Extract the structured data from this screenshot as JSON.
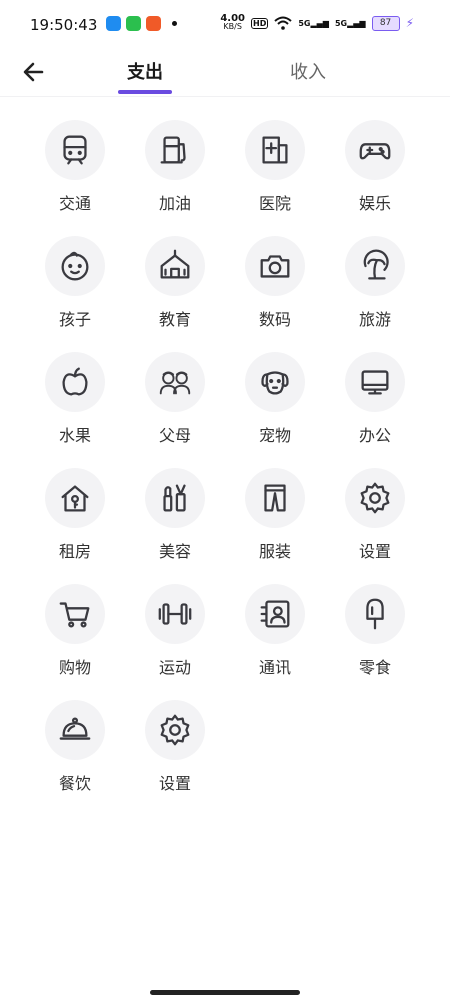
{
  "status_bar": {
    "time": "19:50:43",
    "net_speed_value": "4.00",
    "net_speed_unit": "KB/S",
    "hd": "HD",
    "signal1": "5G",
    "signal2": "5G",
    "battery": "87"
  },
  "header": {
    "tab_expense": "支出",
    "tab_income": "收入"
  },
  "categories": [
    {
      "label": "交通",
      "icon": "train-icon"
    },
    {
      "label": "加油",
      "icon": "fuel-pump-icon"
    },
    {
      "label": "医院",
      "icon": "hospital-icon"
    },
    {
      "label": "娱乐",
      "icon": "gamepad-icon"
    },
    {
      "label": "孩子",
      "icon": "baby-face-icon"
    },
    {
      "label": "教育",
      "icon": "school-icon"
    },
    {
      "label": "数码",
      "icon": "camera-icon"
    },
    {
      "label": "旅游",
      "icon": "palm-tree-icon"
    },
    {
      "label": "水果",
      "icon": "apple-icon"
    },
    {
      "label": "父母",
      "icon": "parents-icon"
    },
    {
      "label": "宠物",
      "icon": "dog-icon"
    },
    {
      "label": "办公",
      "icon": "monitor-icon"
    },
    {
      "label": "租房",
      "icon": "house-key-icon"
    },
    {
      "label": "美容",
      "icon": "makeup-icon"
    },
    {
      "label": "服装",
      "icon": "pants-icon"
    },
    {
      "label": "设置",
      "icon": "gear-icon"
    },
    {
      "label": "购物",
      "icon": "shopping-cart-icon"
    },
    {
      "label": "运动",
      "icon": "dumbbell-icon"
    },
    {
      "label": "通讯",
      "icon": "contacts-icon"
    },
    {
      "label": "零食",
      "icon": "popsicle-icon"
    },
    {
      "label": "餐饮",
      "icon": "food-cloche-icon"
    },
    {
      "label": "设置",
      "icon": "gear-icon"
    }
  ],
  "colors": {
    "accent": "#6a4be0",
    "icon_bg": "#f3f3f5",
    "icon_stroke": "#3a3a40"
  }
}
